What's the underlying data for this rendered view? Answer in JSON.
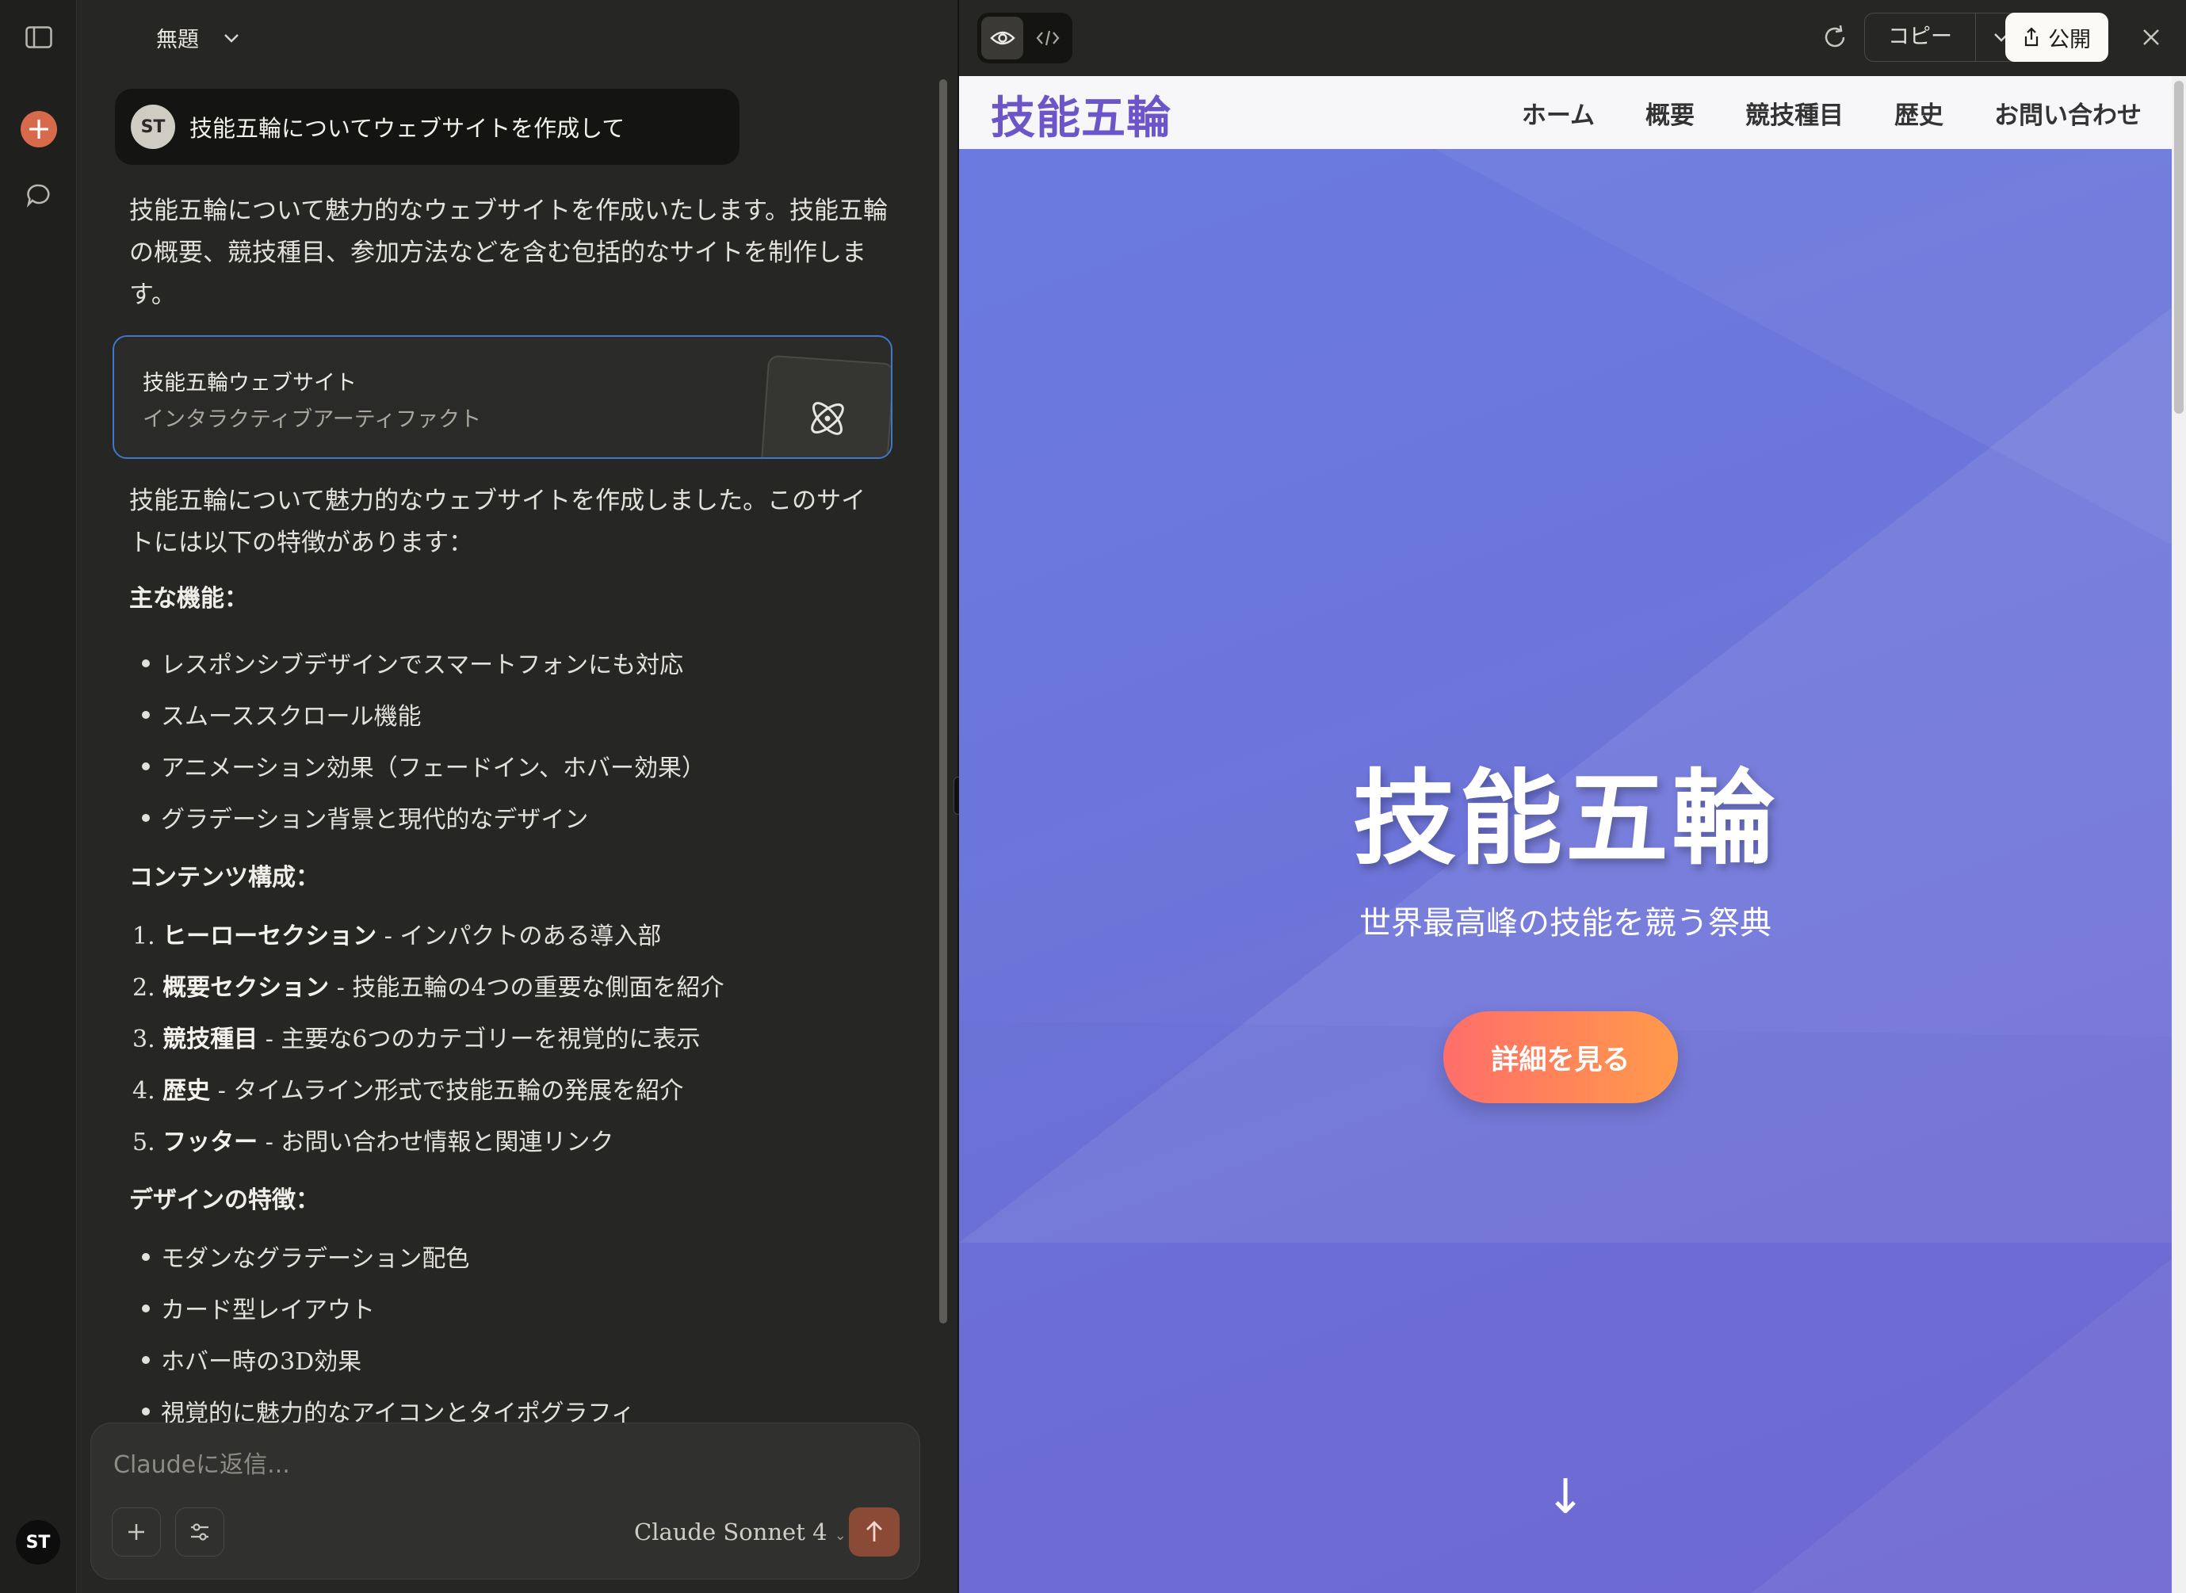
{
  "chat": {
    "title": "無題",
    "user_avatar": "ST",
    "user_message": "技能五輪についてウェブサイトを作成して",
    "intro": "技能五輪について魅力的なウェブサイトを作成いたします。技能五輪の概要、競技種目、参加方法などを含む包括的なサイトを制作します。",
    "artifact": {
      "title": "技能五輪ウェブサイト",
      "subtitle": "インタラクティブアーティファクト",
      "icon": "react-atom-icon"
    },
    "summary": "技能五輪について魅力的なウェブサイトを作成しました。このサイトには以下の特徴があります：",
    "features_heading": "主な機能：",
    "features": [
      "レスポンシブデザインでスマートフォンにも対応",
      "スムーススクロール機能",
      "アニメーション効果（フェードイン、ホバー効果）",
      "グラデーション背景と現代的なデザイン"
    ],
    "content_heading": "コンテンツ構成：",
    "content_items": [
      {
        "num": "1.",
        "bold": "ヒーローセクション",
        "rest": " - インパクトのある導入部"
      },
      {
        "num": "2.",
        "bold": "概要セクション",
        "rest": " - 技能五輪の4つの重要な側面を紹介"
      },
      {
        "num": "3.",
        "bold": "競技種目",
        "rest": " - 主要な6つのカテゴリーを視覚的に表示"
      },
      {
        "num": "4.",
        "bold": "歴史",
        "rest": " - タイムライン形式で技能五輪の発展を紹介"
      },
      {
        "num": "5.",
        "bold": "フッター",
        "rest": " - お問い合わせ情報と関連リンク"
      }
    ],
    "design_heading": "デザインの特徴：",
    "design_items": [
      "モダンなグラデーション配色",
      "カード型レイアウト",
      "ホバー時の3D効果",
      "視覚的に魅力的なアイコンとタイポグラフィ"
    ]
  },
  "composer": {
    "placeholder": "Claudeに返信...",
    "model": "Claude Sonnet 4"
  },
  "rail": {
    "user_initials": "ST"
  },
  "panel": {
    "copy_label": "コピー",
    "publish_label": "公開"
  },
  "site": {
    "logo": "技能五輪",
    "nav": [
      "ホーム",
      "概要",
      "競技種目",
      "歴史",
      "お問い合わせ"
    ],
    "hero_title": "技能五輪",
    "hero_subtitle": "世界最高峰の技能を競う祭典",
    "cta": "詳細を見る",
    "scroll_arrow": "↓"
  },
  "colors": {
    "accent_orange": "#d66a4a",
    "artifact_border": "#3f78c9",
    "logo_purple": "#6c55c9",
    "hero_start": "#6a7be0",
    "hero_end": "#7268d4",
    "cta_start": "#ff6e6a",
    "cta_end": "#ff9a4a"
  }
}
